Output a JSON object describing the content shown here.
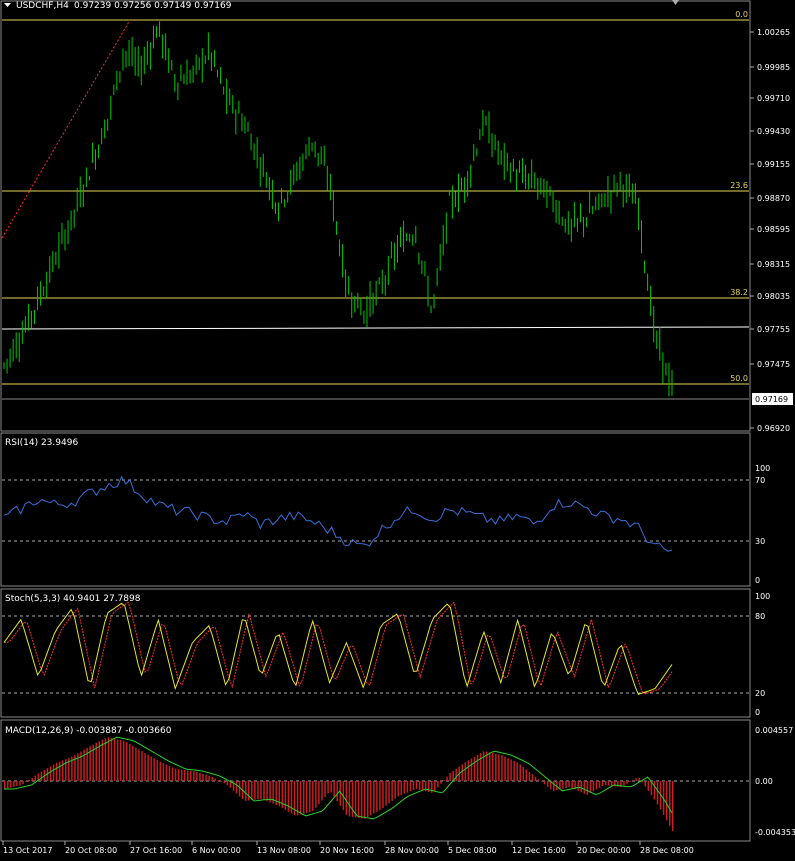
{
  "main": {
    "symbol_label": "USDCHF,H4",
    "ohlc_label": "0.97239 0.97256 0.97149 0.97169",
    "current_price": "0.97169",
    "price_axis": [
      "1.00265",
      "0.99985",
      "0.99710",
      "0.99430",
      "0.99155",
      "0.98870",
      "0.98595",
      "0.98315",
      "0.98035",
      "0.97755",
      "0.97475",
      "0.96920"
    ],
    "fib_levels": [
      "0.0",
      "23.6",
      "38.2",
      "50.0"
    ],
    "colors": {
      "candles": "#00c800",
      "fib": "#e6d35a",
      "trend": "#ff2a2a",
      "bg": "#000000"
    }
  },
  "rsi": {
    "label": "RSI(14) 23.9496",
    "axis": [
      "100",
      "70",
      "30",
      "0"
    ],
    "color": "#3a6fd8"
  },
  "stoch": {
    "label": "Stoch(5,3,3) 40.9401 27.7898",
    "axis": [
      "100",
      "80",
      "20",
      "0"
    ],
    "main_color": "#e6e62a",
    "signal_color": "#ff3030"
  },
  "macd": {
    "label": "MACD(12,26,9) -0.003887 -0.003660",
    "axis": [
      "0.004557",
      "0.00",
      "-0.004353"
    ],
    "hist_color": "#c81e1e",
    "signal_color": "#28d228"
  },
  "time_axis": [
    "13 Oct 2017",
    "20 Oct 08:00",
    "27 Oct 16:00",
    "6 Nov 00:00",
    "13 Nov 08:00",
    "20 Nov 16:00",
    "28 Nov 00:00",
    "5 Dec 08:00",
    "12 Dec 16:00",
    "20 Dec 00:00",
    "28 Dec 08:00"
  ],
  "chart_data": {
    "type": "line",
    "title": "USDCHF,H4",
    "price_close_approx": [
      0.9745,
      0.977,
      0.98,
      0.9835,
      0.987,
      0.991,
      0.995,
      1.001,
      0.9995,
      1.003,
      0.9985,
      0.999,
      1.001,
      0.997,
      0.995,
      0.9915,
      0.988,
      0.9905,
      0.9935,
      0.99,
      0.981,
      0.979,
      0.981,
      0.9845,
      0.986,
      0.979,
      0.988,
      0.99,
      0.995,
      0.992,
      0.9905,
      0.99,
      0.9885,
      0.986,
      0.987,
      0.9885,
      0.99,
      0.988,
      0.977,
      0.9725
    ],
    "rsi_values_approx": [
      48,
      55,
      62,
      58,
      60,
      66,
      72,
      76,
      66,
      58,
      54,
      52,
      48,
      46,
      52,
      44,
      48,
      50,
      46,
      40,
      32,
      28,
      40,
      50,
      55,
      48,
      54,
      52,
      48,
      46,
      50,
      44,
      58,
      60,
      56,
      50,
      48,
      42,
      28,
      24
    ],
    "stoch_values_approx": [
      60,
      80,
      30,
      70,
      90,
      20,
      85,
      95,
      30,
      80,
      20,
      60,
      75,
      20,
      85,
      30,
      70,
      20,
      80,
      25,
      60,
      20,
      75,
      85,
      30,
      80,
      95,
      20,
      70,
      25,
      80,
      20,
      70,
      30,
      80,
      20,
      60,
      15,
      20,
      41
    ]
  }
}
